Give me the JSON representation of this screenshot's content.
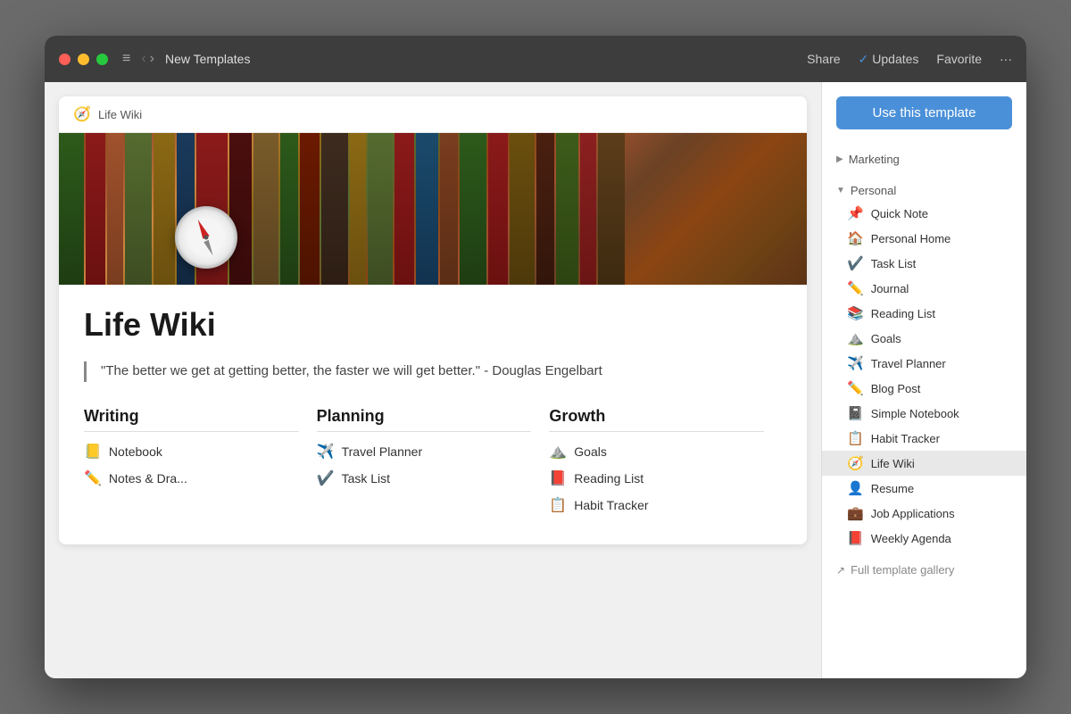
{
  "titlebar": {
    "title": "New Templates",
    "actions": {
      "share": "Share",
      "updates": "Updates",
      "favorite": "Favorite",
      "more": "···"
    }
  },
  "preview": {
    "header_icon": "🧭",
    "header_title": "Life Wiki",
    "page_title": "Life Wiki",
    "quote": "\"The better we get at getting better, the faster we will get better.\" - Douglas Engelbart",
    "columns": [
      {
        "title": "Writing",
        "items": [
          {
            "icon": "📒",
            "label": "Notebook"
          },
          {
            "icon": "✏️",
            "label": "Notes & Dra..."
          }
        ]
      },
      {
        "title": "Planning",
        "items": [
          {
            "icon": "✈️",
            "label": "Travel Planner"
          },
          {
            "icon": "✔️",
            "label": "Task List"
          }
        ]
      },
      {
        "title": "Growth",
        "items": [
          {
            "icon": "⛰️",
            "label": "Goals"
          },
          {
            "icon": "📕",
            "label": "Reading List"
          },
          {
            "icon": "📋",
            "label": "Habit Tracker"
          }
        ]
      }
    ]
  },
  "sidebar": {
    "use_template_label": "Use this template",
    "sections": [
      {
        "name": "Marketing",
        "expanded": false,
        "arrow": "▶",
        "items": []
      },
      {
        "name": "Personal",
        "expanded": true,
        "arrow": "▼",
        "items": [
          {
            "emoji": "📌",
            "label": "Quick Note",
            "active": false
          },
          {
            "emoji": "🏠",
            "label": "Personal Home",
            "active": false
          },
          {
            "emoji": "✔️",
            "label": "Task List",
            "active": false
          },
          {
            "emoji": "✏️",
            "label": "Journal",
            "active": false
          },
          {
            "emoji": "📚",
            "label": "Reading List",
            "active": false
          },
          {
            "emoji": "⛰️",
            "label": "Goals",
            "active": false
          },
          {
            "emoji": "✈️",
            "label": "Travel Planner",
            "active": false
          },
          {
            "emoji": "✏️",
            "label": "Blog Post",
            "active": false
          },
          {
            "emoji": "📓",
            "label": "Simple Notebook",
            "active": false
          },
          {
            "emoji": "📋",
            "label": "Habit Tracker",
            "active": false
          },
          {
            "emoji": "🧭",
            "label": "Life Wiki",
            "active": true
          },
          {
            "emoji": "👤",
            "label": "Resume",
            "active": false
          },
          {
            "emoji": "💼",
            "label": "Job Applications",
            "active": false
          },
          {
            "emoji": "📕",
            "label": "Weekly Agenda",
            "active": false
          }
        ]
      }
    ],
    "footer": {
      "icon": "↗",
      "label": "Full template gallery"
    }
  }
}
